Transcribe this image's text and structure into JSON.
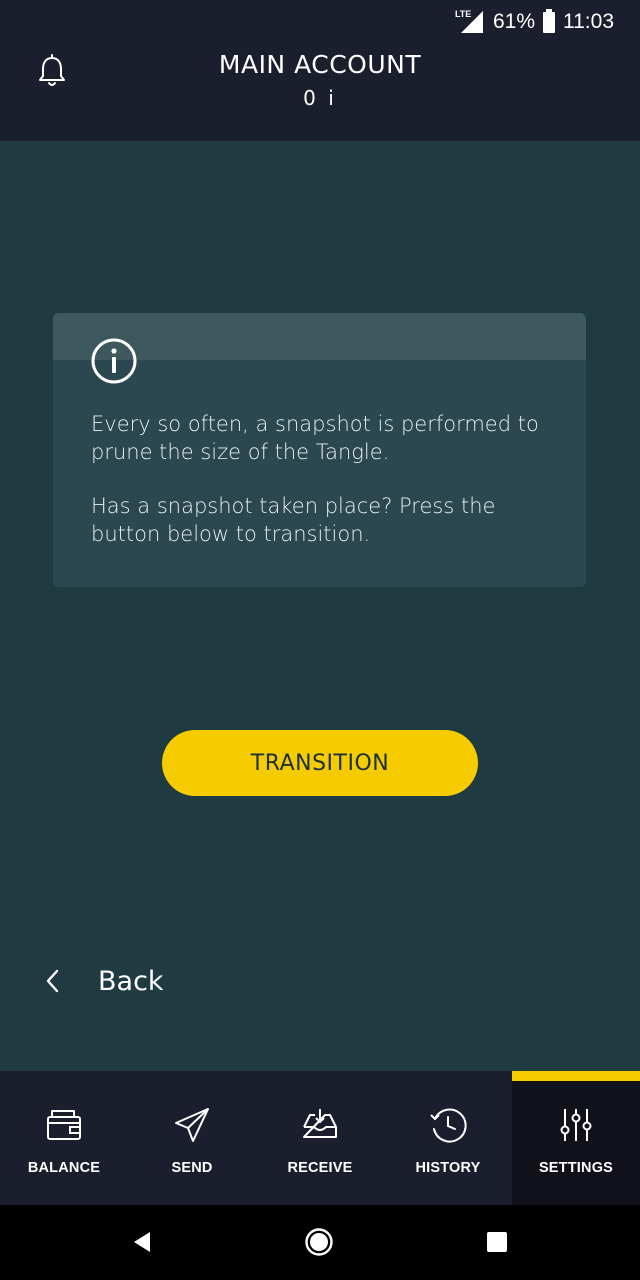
{
  "status_bar": {
    "network": "LTE",
    "battery_percent": "61%",
    "time": "11:03"
  },
  "header": {
    "title": "MAIN ACCOUNT",
    "balance": "0 i",
    "bell_icon": "bell-icon"
  },
  "info_card": {
    "icon": "info-icon",
    "paragraph_1": "Every so often, a snapshot is performed to prune the size of the Tangle.",
    "paragraph_2": "Has a snapshot taken place? Press the button below to transition."
  },
  "transition_button": {
    "label": "TRANSITION"
  },
  "back": {
    "label": "Back",
    "icon": "chevron-left-icon"
  },
  "bottom_nav": {
    "active_index": 4,
    "items": [
      {
        "label": "BALANCE",
        "icon": "wallet-icon"
      },
      {
        "label": "SEND",
        "icon": "paper-plane-icon"
      },
      {
        "label": "RECEIVE",
        "icon": "inbox-icon"
      },
      {
        "label": "HISTORY",
        "icon": "history-icon"
      },
      {
        "label": "SETTINGS",
        "icon": "sliders-icon"
      }
    ]
  },
  "colors": {
    "background": "#1f3a41",
    "header": "#1b1e2d",
    "accent": "#f6cc00",
    "card": "#2b4850"
  },
  "system_nav": {
    "back_icon": "nav-back-triangle-icon",
    "home_icon": "nav-home-circle-icon",
    "recents_icon": "nav-recents-square-icon"
  }
}
